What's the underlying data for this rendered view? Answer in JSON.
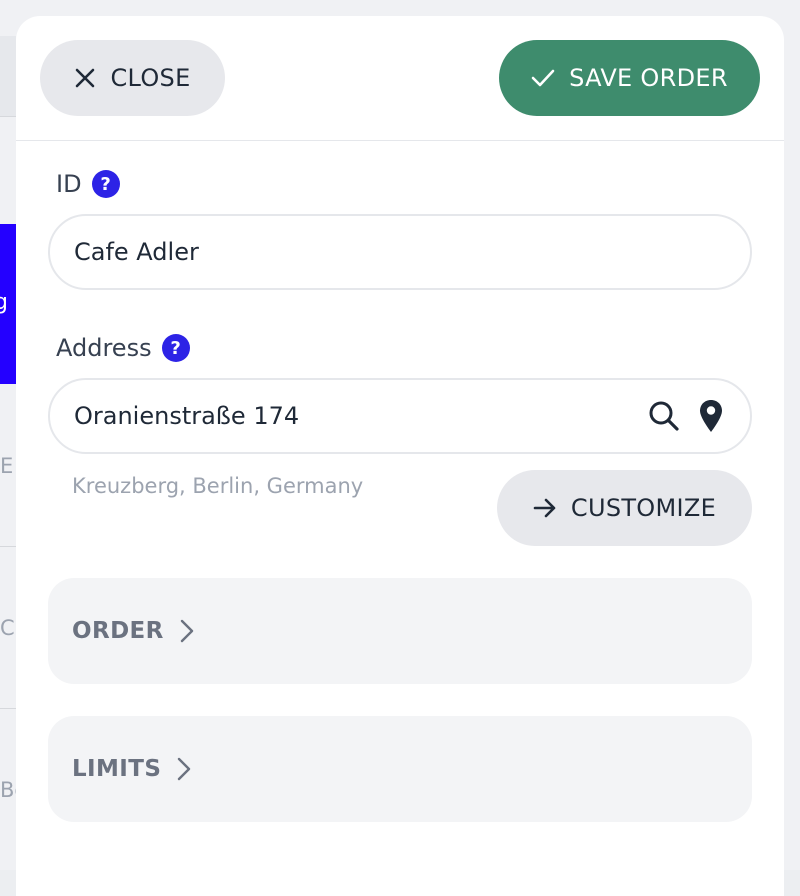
{
  "background": {
    "blue_fragment": "g",
    "fragments": [
      "E",
      "C",
      "Be"
    ]
  },
  "header": {
    "close_label": "CLOSE",
    "close_icon": "close-icon",
    "save_label": "SAVE ORDER",
    "save_icon": "check-icon",
    "save_color": "#3e8c6d"
  },
  "form": {
    "id": {
      "label": "ID",
      "help": "?",
      "value": "Cafe Adler"
    },
    "address": {
      "label": "Address",
      "help": "?",
      "value": "Oranienstraße 174",
      "hint": "Kreuzberg, Berlin, Germany",
      "icons": [
        "search-icon",
        "map-pin-icon"
      ]
    },
    "customize_label": "CUSTOMIZE",
    "customize_icon": "arrow-right-icon",
    "help_color": "#2d23e6"
  },
  "sections": [
    {
      "label": "ORDER",
      "icon": "chevron-right-icon"
    },
    {
      "label": "LIMITS",
      "icon": "chevron-right-icon"
    }
  ]
}
